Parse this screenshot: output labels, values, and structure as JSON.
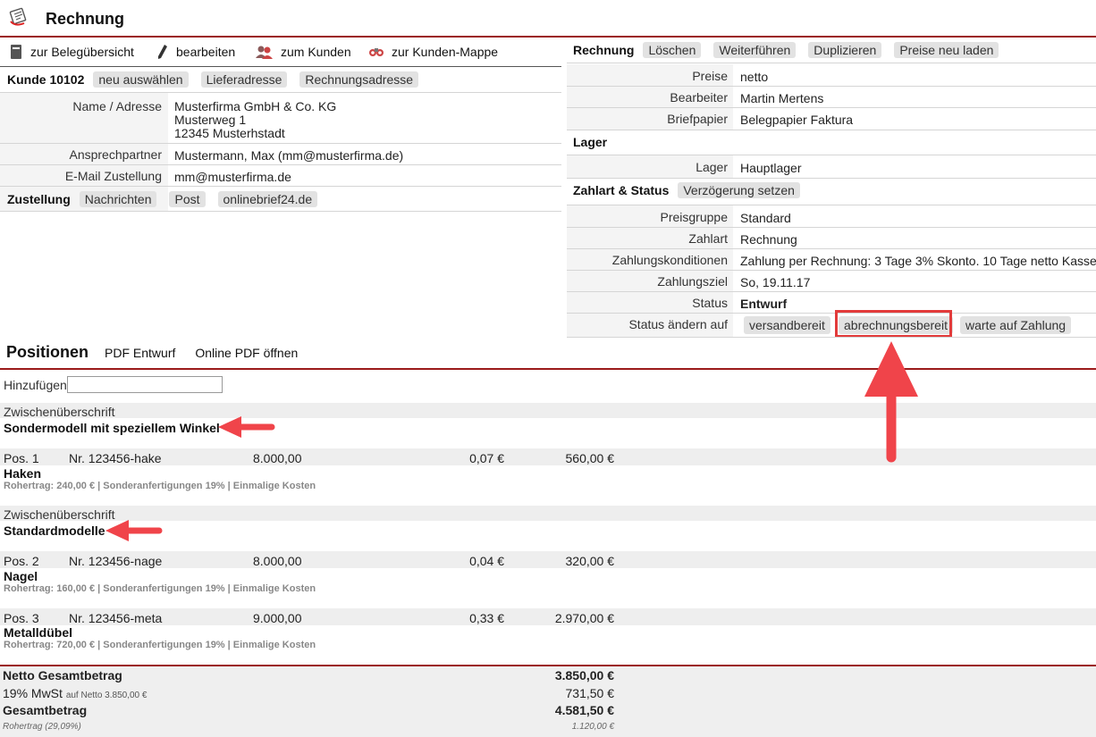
{
  "header": {
    "title": "Rechnung"
  },
  "toolbar": {
    "beleg": "zur Belegübersicht",
    "edit": "bearbeiten",
    "kunde": "zum Kunden",
    "mappe": "zur Kunden-Mappe"
  },
  "kunde": {
    "heading": "Kunde 10102",
    "buttons": [
      "neu auswählen",
      "Lieferadresse",
      "Rechnungsadresse"
    ],
    "name_label": "Name / Adresse",
    "name_lines": [
      "Musterfirma GmbH & Co. KG",
      "Musterweg 1",
      "12345 Musterhstadt"
    ],
    "contact_label": "Ansprechpartner",
    "contact_value": "Mustermann, Max (mm@musterfirma.de)",
    "email_label": "E-Mail Zustellung",
    "email_value": "mm@musterfirma.de"
  },
  "zustellung": {
    "heading": "Zustellung",
    "buttons": [
      "Nachrichten",
      "Post",
      "onlinebrief24.de"
    ]
  },
  "rechnung": {
    "heading": "Rechnung",
    "buttons": [
      "Löschen",
      "Weiterführen",
      "Duplizieren",
      "Preise neu laden"
    ],
    "rows": [
      {
        "label": "Preise",
        "value": "netto"
      },
      {
        "label": "Bearbeiter",
        "value": "Martin Mertens"
      },
      {
        "label": "Briefpapier",
        "value": "Belegpapier Faktura"
      }
    ]
  },
  "lager": {
    "heading": "Lager",
    "label": "Lager",
    "value": "Hauptlager"
  },
  "zahlart": {
    "heading": "Zahlart & Status",
    "button": "Verzögerung setzen",
    "rows": [
      {
        "label": "Preisgruppe",
        "value": "Standard"
      },
      {
        "label": "Zahlart",
        "value": "Rechnung"
      },
      {
        "label": "Zahlungskonditionen",
        "value": "Zahlung per Rechnung: 3 Tage 3% Skonto. 10 Tage netto Kasse."
      },
      {
        "label": "Zahlungsziel",
        "value": "So, 19.11.17"
      },
      {
        "label": "Status",
        "value": "Entwurf"
      }
    ],
    "status_change_label": "Status ändern auf",
    "status_buttons": [
      "versandbereit",
      "abrechnungsbereit",
      "warte auf Zahlung"
    ]
  },
  "positionen": {
    "heading": "Positionen",
    "pdf_entwurf": "PDF Entwurf",
    "online_pdf": "Online PDF öffnen",
    "add_label": "Hinzufügen",
    "add_value": "",
    "subheading_label": "Zwischenüberschrift",
    "groups": [
      {
        "title": "Sondermodell mit speziellem Winkel"
      },
      {
        "title": "Standardmodelle"
      }
    ],
    "items": [
      {
        "pos": "Pos. 1",
        "nr": "Nr. 123456-hake",
        "qty": "8.000,00",
        "price": "0,07 €",
        "total": "560,00 €",
        "name": "Haken",
        "meta": "Rohertrag: 240,00 € | Sonderanfertigungen 19% | Einmalige Kosten"
      },
      {
        "pos": "Pos. 2",
        "nr": "Nr. 123456-nage",
        "qty": "8.000,00",
        "price": "0,04 €",
        "total": "320,00 €",
        "name": "Nagel",
        "meta": "Rohertrag: 160,00 € | Sonderanfertigungen 19% | Einmalige Kosten"
      },
      {
        "pos": "Pos. 3",
        "nr": "Nr. 123456-meta",
        "qty": "9.000,00",
        "price": "0,33 €",
        "total": "2.970,00 €",
        "name": "Metalldübel",
        "meta": "Rohertrag: 720,00 € | Sonderanfertigungen 19% | Einmalige Kosten"
      }
    ]
  },
  "totals": {
    "netto_label": "Netto Gesamtbetrag",
    "netto_value": "3.850,00 €",
    "mwst_label": "19% MwSt",
    "mwst_note": "auf Netto 3.850,00 €",
    "mwst_value": "731,50 €",
    "gesamt_label": "Gesamtbetrag",
    "gesamt_value": "4.581,50 €",
    "rohertrag_label": "Rohertrag (29,09%)",
    "rohertrag_value": "1.120,00 €"
  },
  "colors": {
    "accent_line": "#9b1b1b",
    "highlight": "#e23b3b",
    "arrow": "#f0444a"
  }
}
